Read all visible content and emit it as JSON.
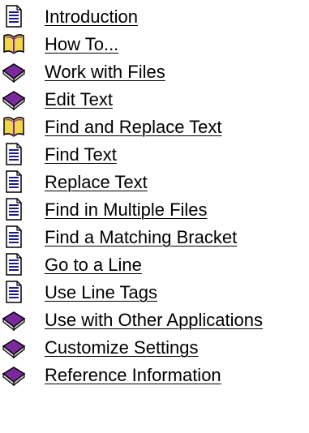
{
  "window": {
    "title": ""
  },
  "toc": {
    "items": [
      {
        "label": "Introduction",
        "icon": "topic-page-icon"
      },
      {
        "label": "How To...",
        "icon": "open-book-icon"
      },
      {
        "label": "Work with Files",
        "icon": "closed-book-icon"
      },
      {
        "label": "Edit Text",
        "icon": "closed-book-icon"
      },
      {
        "label": "Find and Replace Text",
        "icon": "open-book-icon"
      },
      {
        "label": "Find Text",
        "icon": "topic-page-icon"
      },
      {
        "label": "Replace Text",
        "icon": "topic-page-icon"
      },
      {
        "label": "Find in Multiple Files",
        "icon": "topic-page-icon"
      },
      {
        "label": "Find a Matching Bracket",
        "icon": "topic-page-icon"
      },
      {
        "label": "Go to a Line",
        "icon": "topic-page-icon"
      },
      {
        "label": "Use Line Tags",
        "icon": "topic-page-icon"
      },
      {
        "label": "Use with Other Applications",
        "icon": "closed-book-icon"
      },
      {
        "label": "Customize Settings",
        "icon": "closed-book-icon"
      },
      {
        "label": "Reference Information",
        "icon": "closed-book-icon"
      }
    ]
  },
  "colors": {
    "link_text": "#000000",
    "page_fill": "#ffffff",
    "page_lines": "#1a1a8c",
    "book_purple": "#7a2a9a",
    "book_open_yellow": "#f2d64a"
  }
}
